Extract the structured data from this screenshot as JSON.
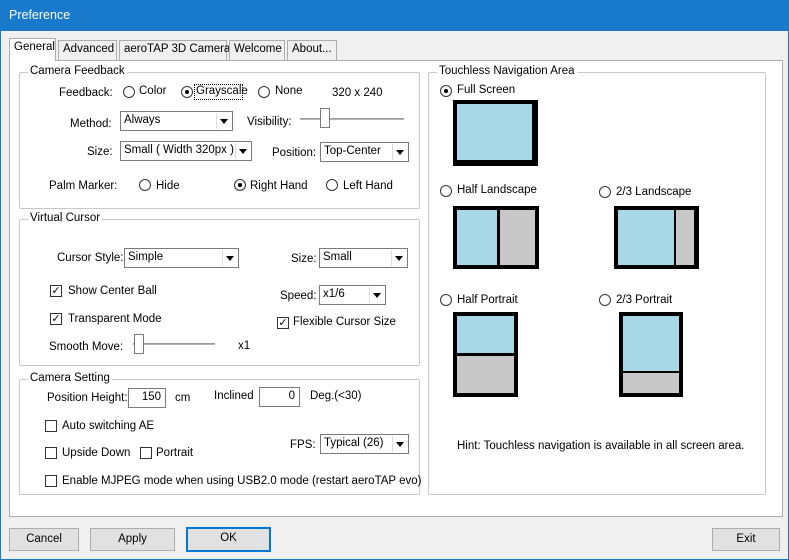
{
  "window": {
    "title": "Preference"
  },
  "tabs": [
    "General",
    "Advanced",
    "aeroTAP 3D Camera",
    "Welcome",
    "About..."
  ],
  "camera_feedback": {
    "group_label": "Camera Feedback",
    "feedback_label": "Feedback:",
    "feedback_options": [
      "Color",
      "Grayscale",
      "None"
    ],
    "feedback_selected": "Grayscale",
    "resolution": "320 x 240",
    "method_label": "Method:",
    "method_value": "Always",
    "visibility_label": "Visibility:",
    "visibility_level": 0.15,
    "size_label": "Size:",
    "size_value": "Small ( Width 320px )",
    "position_label": "Position:",
    "position_value": "Top-Center",
    "palm_marker_label": "Palm Marker:",
    "palm_options": [
      "Hide",
      "Right Hand",
      "Left Hand"
    ],
    "palm_selected": "Right Hand"
  },
  "virtual_cursor": {
    "group_label": "Virtual Cursor",
    "cursor_style_label": "Cursor Style:",
    "cursor_style_value": "Simple",
    "size_label": "Size:",
    "size_value": "Small",
    "show_center_ball_label": "Show Center Ball",
    "show_center_ball": true,
    "speed_label": "Speed:",
    "speed_value": "x1/6",
    "transparent_mode_label": "Transparent Mode",
    "transparent_mode": true,
    "flexible_cursor_size_label": "Flexible Cursor Size",
    "flexible_cursor_size": true,
    "smooth_move_label": "Smooth Move:",
    "smooth_move_level": 0.0,
    "smooth_move_value": "x1"
  },
  "camera_setting": {
    "group_label": "Camera Setting",
    "position_height_label": "Position Height:",
    "position_height_value": "150",
    "position_height_unit": "cm",
    "inclined_label": "Inclined",
    "inclined_value": "0",
    "inclined_unit": "Deg.(<30)",
    "auto_switching_ae_label": "Auto switching AE",
    "auto_switching_ae": false,
    "upside_down_label": "Upside Down",
    "upside_down": false,
    "portrait_label": "Portrait",
    "portrait": false,
    "fps_label": "FPS:",
    "fps_value": "Typical (26)",
    "mjpeg_label": "Enable MJPEG mode when using USB2.0 mode (restart aeroTAP evo)",
    "mjpeg": false
  },
  "touchless_area": {
    "group_label": "Touchless Navigation Area",
    "options": [
      "Full Screen",
      "Half Landscape",
      "2/3 Landscape",
      "Half Portrait",
      "2/3 Portrait"
    ],
    "selected": "Full Screen",
    "hint": "Hint: Touchless navigation is available in all screen area."
  },
  "buttons": {
    "cancel": "Cancel",
    "apply": "Apply",
    "ok": "OK",
    "exit": "Exit"
  },
  "colors": {
    "titlebar": "#1979ca",
    "active_area": "#a8d8e8",
    "inactive_area": "#c8c8c8"
  }
}
